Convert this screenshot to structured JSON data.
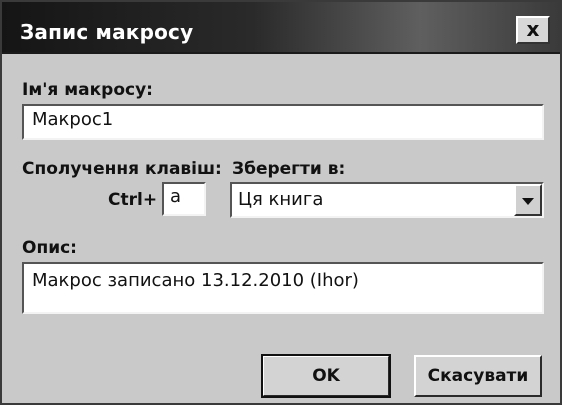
{
  "dialog": {
    "title": "Запис макросу",
    "close_icon": "close-icon",
    "close_label": "x"
  },
  "macro_name": {
    "label": "Ім'я макросу:",
    "value": "Макрос1"
  },
  "shortcut": {
    "label": "Сполучення клавіш:",
    "prefix": "Ctrl+",
    "key_value": "a"
  },
  "save_in": {
    "label": "Зберегти в:",
    "selected": "Ця книга",
    "dropdown_icon": "chevron-down-icon"
  },
  "description": {
    "label": "Опис:",
    "value": "Макрос записано 13.12.2010 (Ihor)"
  },
  "buttons": {
    "ok": "OK",
    "cancel": "Скасувати"
  },
  "colors": {
    "titlebar_dark": "#151515",
    "dialog_bg": "#c9c9c9",
    "field_bg": "#ffffff",
    "text": "#111111"
  }
}
